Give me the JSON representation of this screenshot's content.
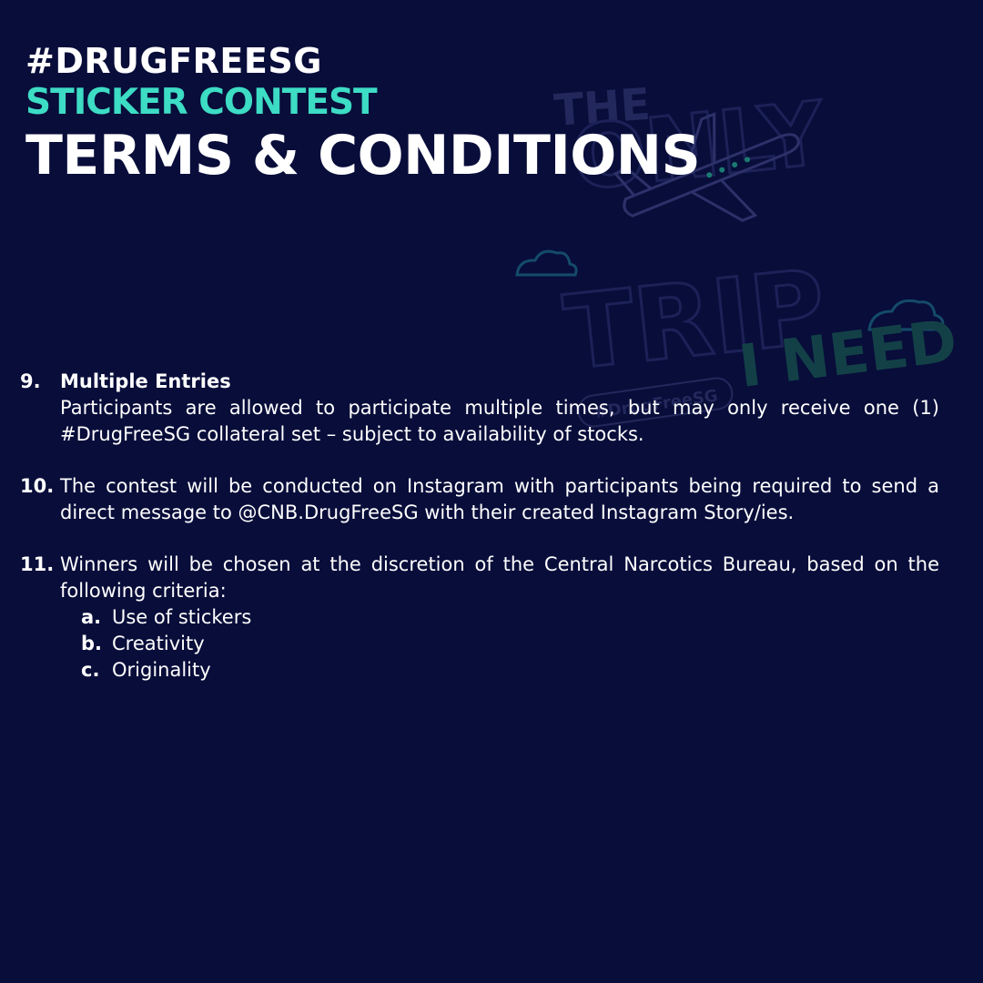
{
  "header": {
    "hashtag": "#DRUGFREESG",
    "subtitle": "STICKER CONTEST",
    "title": "TERMS & CONDITIONS"
  },
  "sticker": {
    "words": [
      "THE",
      "ONLY",
      "TRIP",
      "I NEED"
    ],
    "tag": "#DrugFreeSG",
    "icons": [
      "airplane-icon",
      "cloud-icon"
    ]
  },
  "terms": [
    {
      "number": "9.",
      "heading": "Multiple Entries",
      "text": "Participants are allowed to participate multiple times, but may only receive one (1) #DrugFreeSG collateral set – subject to availability of stocks."
    },
    {
      "number": "10.",
      "text": "The contest will be conducted on Instagram with participants being required to send a direct message to @CNB.DrugFreeSG with their created Instagram Story/ies."
    },
    {
      "number": "11.",
      "text": "Winners will be chosen at the discretion of the Central Narcotics Bureau, based on the following criteria:",
      "criteria": [
        {
          "letter": "a.",
          "text": "Use of stickers"
        },
        {
          "letter": "b.",
          "text": "Creativity"
        },
        {
          "letter": "c.",
          "text": "Originality"
        }
      ]
    }
  ],
  "colors": {
    "background": "#080d3a",
    "accent": "#3ddcc4",
    "text": "#ffffff"
  }
}
